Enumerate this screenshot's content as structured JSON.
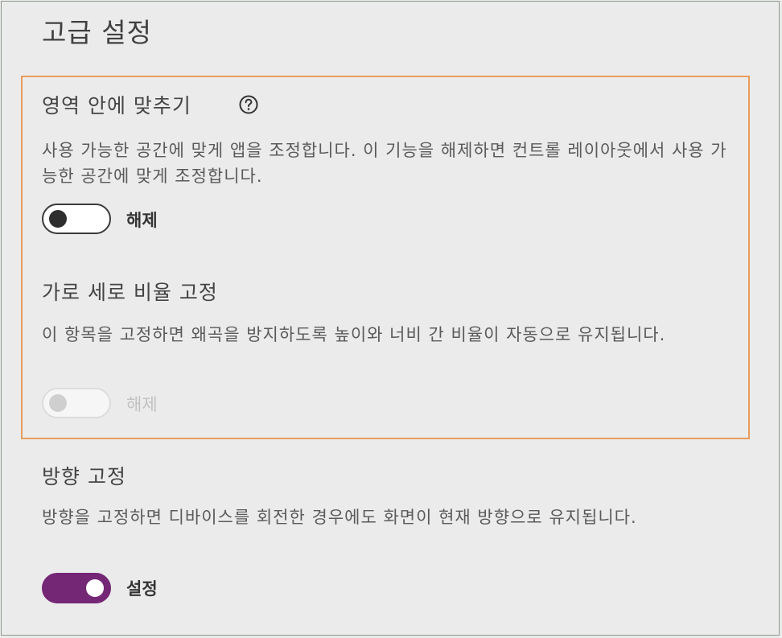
{
  "page": {
    "title": "고급 설정"
  },
  "settings": [
    {
      "title": "영역 안에 맞추기",
      "help_icon": "question-circle-icon",
      "description": "사용 가능한 공간에 맞게 앱을 조정합니다. 이 기능을 해제하면 컨트롤 레이아웃에서 사용 가능한 공간에 맞게 조정합니다.",
      "toggle_state": "off",
      "toggle_label": "해제",
      "highlighted": true
    },
    {
      "title": "가로 세로 비율 고정",
      "description": "이 항목을 고정하면 왜곡을 방지하도록 높이와 너비 간 비율이 자동으로 유지됩니다.",
      "toggle_state": "off-disabled",
      "toggle_label": "해제",
      "highlighted": true
    },
    {
      "title": "방향 고정",
      "description": "방향을 고정하면 디바이스를 회전한 경우에도 화면이 현재 방향으로 유지됩니다.",
      "toggle_state": "on",
      "toggle_label": "설정",
      "highlighted": false
    }
  ],
  "colors": {
    "background": "#ebebeb",
    "highlight_border": "#e89d5e",
    "toggle_on": "#742774",
    "toggle_off_knob": "#2e2e2e",
    "disabled": "#cfcfcf"
  }
}
